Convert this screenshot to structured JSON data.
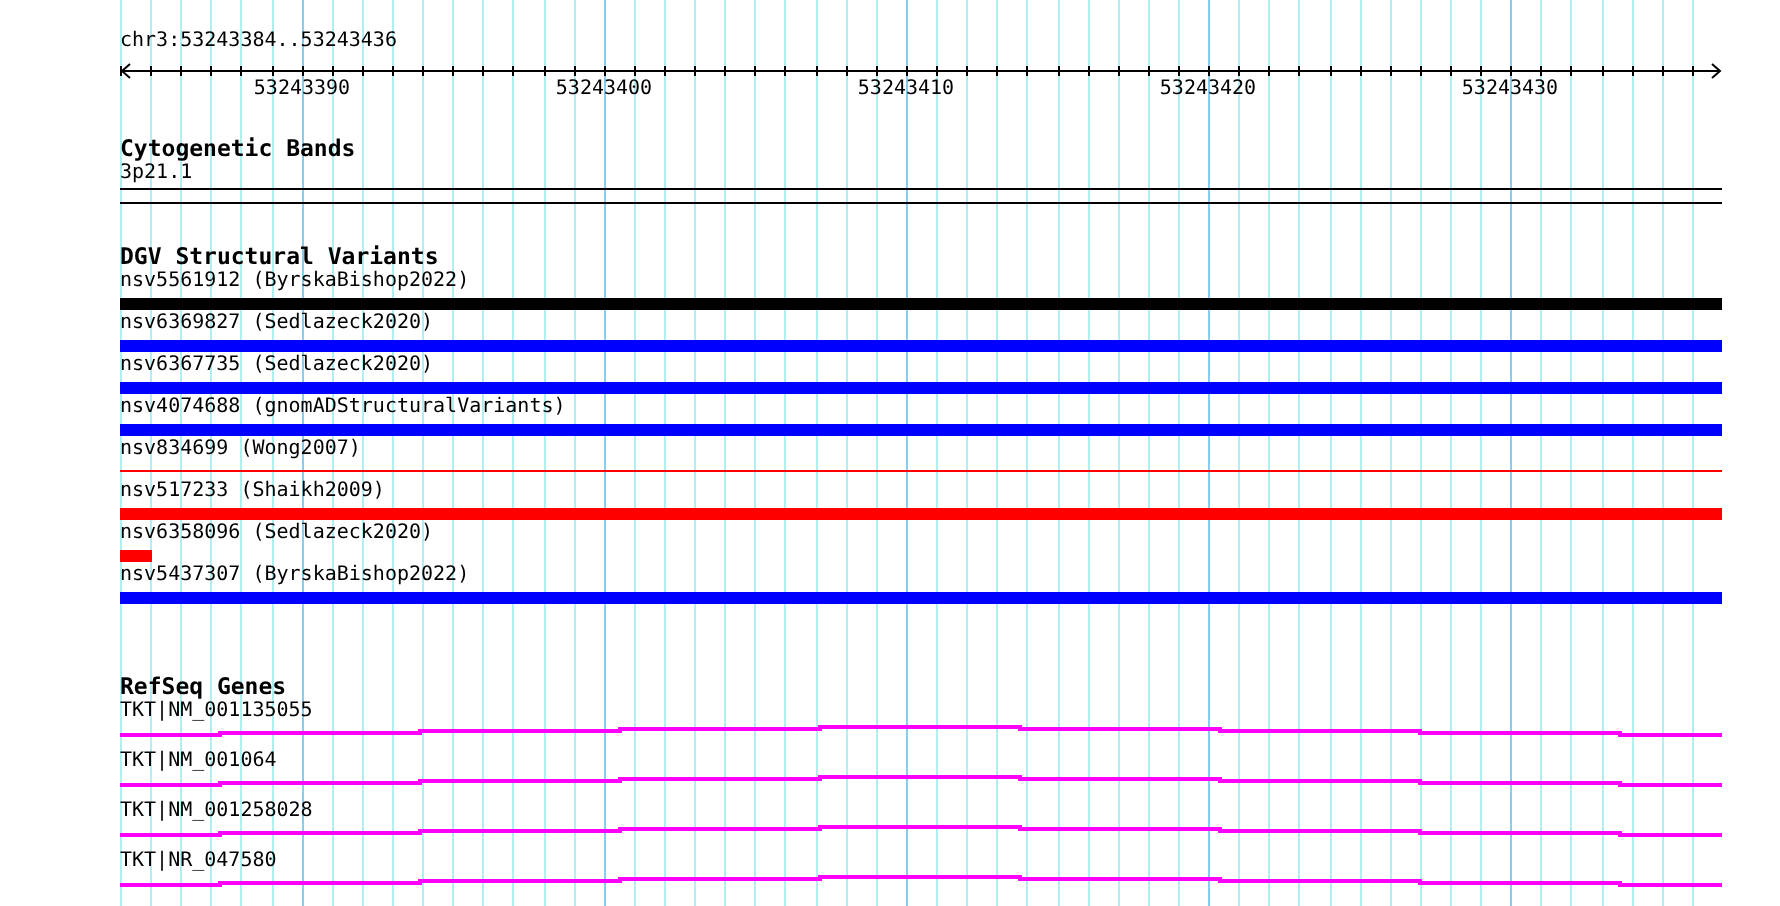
{
  "location": "chr3:53243384..53243436",
  "ruler": {
    "labels": [
      "53243390",
      "53243400",
      "53243410",
      "53243420",
      "53243430"
    ]
  },
  "tracks": [
    {
      "kind": "bands",
      "title": "Cytogenetic Bands",
      "features": [
        {
          "label": "3p21.1"
        }
      ]
    },
    {
      "kind": "variants",
      "title": "DGV Structural Variants",
      "features": [
        {
          "label": "nsv5561912 (ByrskaBishop2022)",
          "color": "#000000",
          "kind": "thick"
        },
        {
          "label": "nsv6369827 (Sedlazeck2020)",
          "color": "#0000ff",
          "kind": "thick"
        },
        {
          "label": "nsv6367735 (Sedlazeck2020)",
          "color": "#0000ff",
          "kind": "thick"
        },
        {
          "label": "nsv4074688 (gnomADStructuralVariants)",
          "color": "#0000ff",
          "kind": "thick"
        },
        {
          "label": "nsv834699 (Wong2007)",
          "color": "#ff0000",
          "kind": "thin"
        },
        {
          "label": "nsv517233 (Shaikh2009)",
          "color": "#ff0000",
          "kind": "thick"
        },
        {
          "label": "nsv6358096 (Sedlazeck2020)",
          "color": "#ff0000",
          "kind": "stub"
        },
        {
          "label": "nsv5437307 (ByrskaBishop2022)",
          "color": "#0000ff",
          "kind": "thick"
        }
      ]
    },
    {
      "kind": "genes",
      "title": "RefSeq Genes",
      "features": [
        {
          "label": "TKT|NM_001135055"
        },
        {
          "label": "TKT|NM_001064"
        },
        {
          "label": "TKT|NM_001258028"
        },
        {
          "label": "TKT|NR_047580"
        }
      ]
    }
  ]
}
